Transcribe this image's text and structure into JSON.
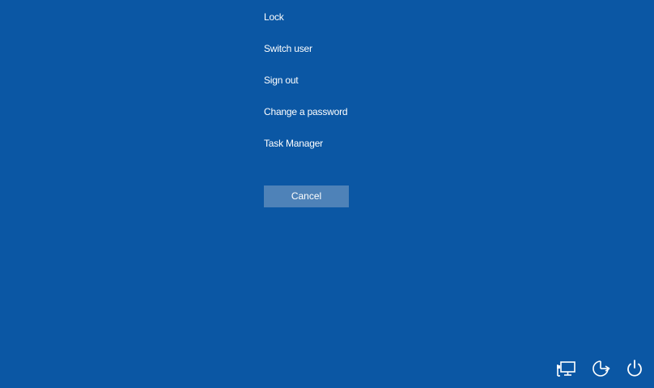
{
  "menu": {
    "items": [
      {
        "label": "Lock"
      },
      {
        "label": "Switch user"
      },
      {
        "label": "Sign out"
      },
      {
        "label": "Change a password"
      },
      {
        "label": "Task Manager"
      }
    ]
  },
  "cancel": {
    "label": "Cancel"
  },
  "tray": {
    "icons": [
      "network-icon",
      "ease-of-access-icon",
      "power-icon"
    ]
  },
  "colors": {
    "background": "#0b57a4",
    "button": "#4e82b8",
    "text": "#ffffff"
  }
}
